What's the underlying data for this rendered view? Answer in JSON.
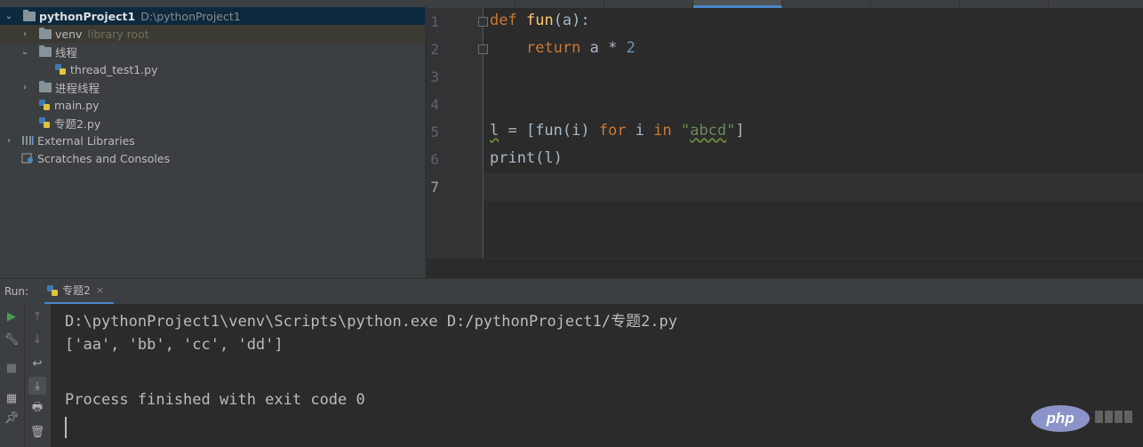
{
  "project_tree": {
    "root": {
      "name": "pythonProject1",
      "path": "D:\\pythonProject1"
    },
    "items": [
      {
        "label": "venv",
        "hint": "library root"
      },
      {
        "label": "线程"
      },
      {
        "label": "thread_test1.py"
      },
      {
        "label": "进程线程"
      },
      {
        "label": "main.py"
      },
      {
        "label": "专题2.py"
      },
      {
        "label": "External Libraries"
      },
      {
        "label": "Scratches and Consoles"
      }
    ]
  },
  "editor": {
    "line_numbers": [
      "1",
      "2",
      "3",
      "4",
      "5",
      "6",
      "7"
    ],
    "current_line": 7,
    "code": {
      "l1_def": "def",
      "l1_name": "fun",
      "l1_rest": "(a):",
      "l2_return": "return",
      "l2_expr": " a * ",
      "l2_num": "2",
      "l5_var": "l",
      "l5_assign": " = [fun(i) ",
      "l5_for": "for",
      "l5_i": " i ",
      "l5_in": "in",
      "l5_space": " ",
      "l5_q1": "\"",
      "l5_str": "abcd",
      "l5_q2": "\"",
      "l5_end": "]",
      "l6": "print(l)"
    }
  },
  "run_panel": {
    "label": "Run:",
    "tab_label": "专题2",
    "tab_close": "×",
    "console": [
      "D:\\pythonProject1\\venv\\Scripts\\python.exe D:/pythonProject1/专题2.py",
      "['aa', 'bb', 'cc', 'dd']",
      "",
      "Process finished with exit code 0"
    ]
  },
  "watermark": {
    "logo": "php"
  },
  "colors": {
    "keyword": "#cc7832",
    "function": "#ffc66d",
    "number": "#6897bb",
    "string": "#6a8759",
    "accent": "#4a88c7",
    "run_green": "#499c54"
  }
}
